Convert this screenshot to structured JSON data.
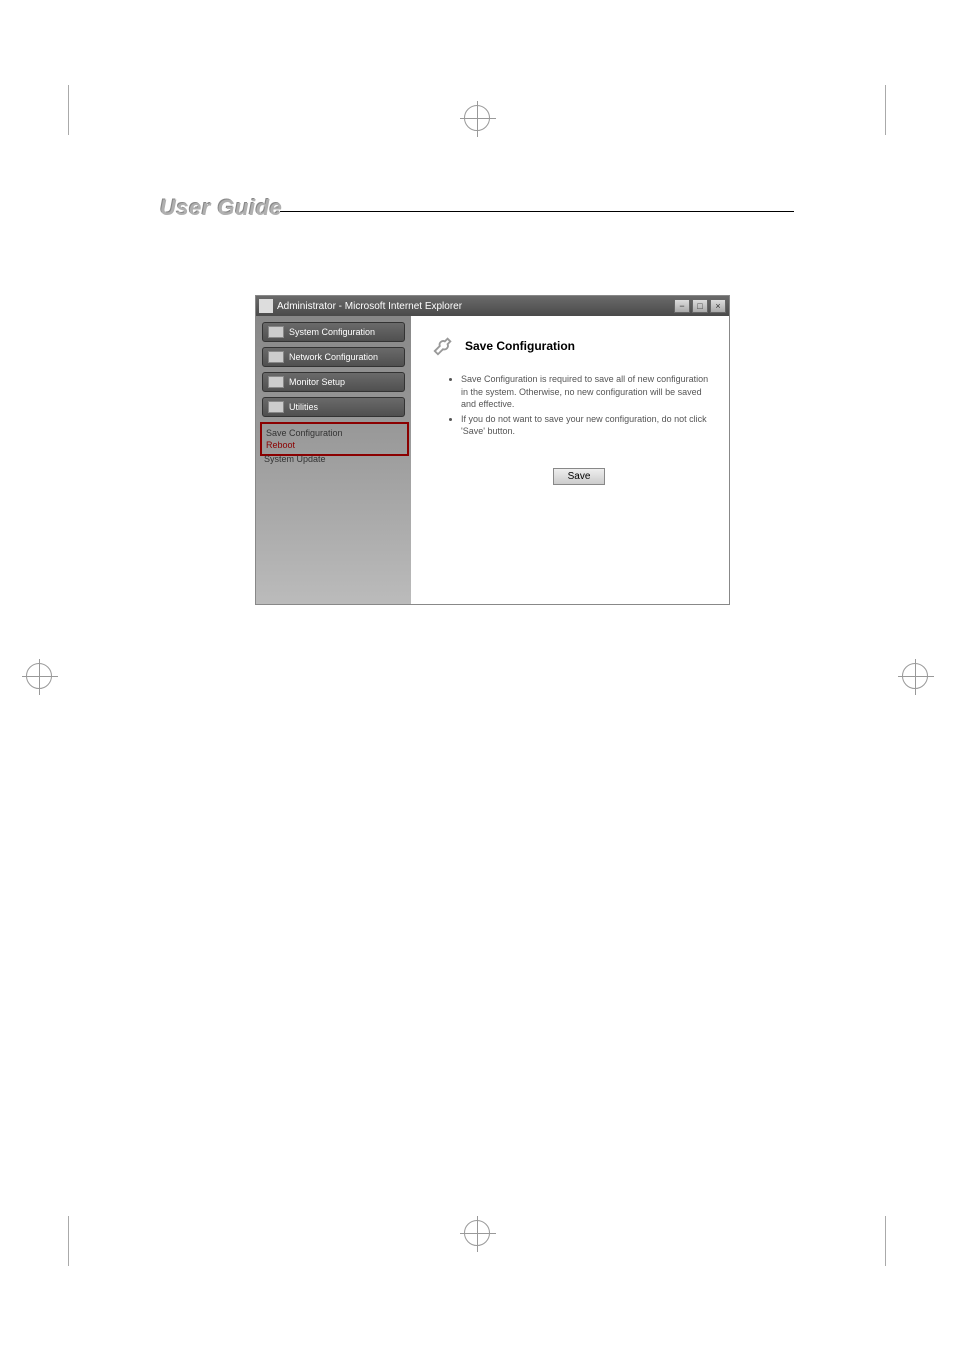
{
  "page": {
    "header_title": "User Guide"
  },
  "window": {
    "title": "Administrator - Microsoft Internet Explorer"
  },
  "sidebar": {
    "nav": [
      {
        "label": "System Configuration"
      },
      {
        "label": "Network Configuration"
      },
      {
        "label": "Monitor Setup"
      },
      {
        "label": "Utilities"
      }
    ],
    "sub_items": [
      {
        "label": "Save Configuration"
      },
      {
        "label": "Reboot"
      },
      {
        "label": "System Update"
      }
    ]
  },
  "content": {
    "title": "Save Configuration",
    "bullets": [
      "Save Configuration is required to save all of new configuration in the system. Otherwise, no new configuration will be saved and effective.",
      "If you do not want to save your new configuration, do not click 'Save' button."
    ],
    "save_button": "Save"
  }
}
